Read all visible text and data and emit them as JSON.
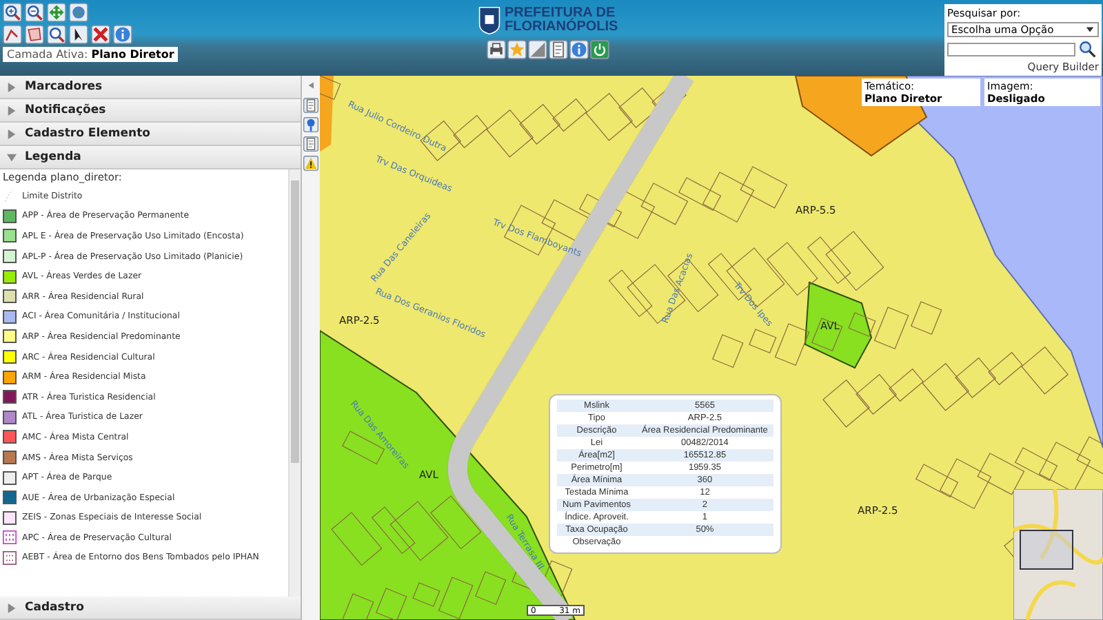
{
  "header": {
    "logo_lines": [
      "PREFEITURA DE",
      "FLORIANÓPOLIS"
    ],
    "active_layer_label": "Camada Ativa:",
    "active_layer": "Plano Diretor"
  },
  "search": {
    "label": "Pesquisar por:",
    "select_value": "Escolha uma Opção",
    "query_builder": "Query Builder"
  },
  "sidebar": {
    "sections": [
      {
        "title": "Marcadores",
        "expanded": false
      },
      {
        "title": "Notificações",
        "expanded": false
      },
      {
        "title": "Cadastro Elemento",
        "expanded": false
      },
      {
        "title": "Legenda",
        "expanded": true,
        "legend": {
          "title": "Legenda plano_diretor:",
          "items": [
            {
              "label": "Limite Distrito",
              "kind": "dots",
              "color": "#c8c8c8"
            },
            {
              "label": "APP - Área de Preservação Permanente",
              "kind": "swatch",
              "color": "#5fb860"
            },
            {
              "label": "APL E - Área de Preservação Uso Limitado (Encosta)",
              "kind": "swatch",
              "color": "#99e08f"
            },
            {
              "label": "APL-P - Área de Preservação Uso Limitado (Planicie)",
              "kind": "swatch",
              "color": "#d4f5d4"
            },
            {
              "label": "AVL - Áreas Verdes de Lazer",
              "kind": "swatch",
              "color": "#99ee00"
            },
            {
              "label": "ARR - Área Residencial Rural",
              "kind": "swatch",
              "color": "#dfe0b0"
            },
            {
              "label": "ACI - Área Comunitária / Institucional",
              "kind": "swatch",
              "color": "#a8b8f0"
            },
            {
              "label": "ARP - Área Residencial Predominante",
              "kind": "swatch",
              "color": "#ffff88"
            },
            {
              "label": "ARC - Área Residencial Cultural",
              "kind": "swatch",
              "color": "#ffff00"
            },
            {
              "label": "ARM - Área Residencial Mista",
              "kind": "swatch",
              "color": "#ffa500"
            },
            {
              "label": "ATR - Área Turistica Residencial",
              "kind": "swatch",
              "color": "#80185a"
            },
            {
              "label": "ATL - Área Turistica de Lazer",
              "kind": "swatch",
              "color": "#b088c8"
            },
            {
              "label": "AMC - Área Mista Central",
              "kind": "swatch",
              "color": "#ff5555"
            },
            {
              "label": "AMS - Área Mista Serviços",
              "kind": "swatch",
              "color": "#b87850"
            },
            {
              "label": "APT - Área de Parque",
              "kind": "swatch",
              "color": "#eeeeee"
            },
            {
              "label": "AUE - Área de Urbanização Especial",
              "kind": "swatch",
              "color": "#106890"
            },
            {
              "label": "ZEIS - Zonas Especiais de Interesse Social",
              "kind": "swatch",
              "color": "#fde4f8"
            },
            {
              "label": "APC - Área de Preservação Cultural",
              "kind": "hatch",
              "color": "#c040c0"
            },
            {
              "label": "AEBT - Área de Entorno dos Bens Tombados pelo IPHAN",
              "kind": "dotted",
              "color": "#905070"
            }
          ]
        }
      },
      {
        "title": "Cadastro",
        "expanded": false
      }
    ]
  },
  "thematic": {
    "tematico_label": "Temático:",
    "tematico_value": "Plano Diretor",
    "imagem_label": "Imagem:",
    "imagem_value": "Desligado"
  },
  "map": {
    "labels": [
      "Rua Julio Cordeiro Dutra",
      "Trv Das Orquideas",
      "Trv Dos Flamboyants",
      "Rua Das Caneleiras",
      "Rua Dos Geranios Floridos",
      "Rua Das Amoreiras",
      "Rua Das Acacias",
      "Trv Dos Ipes",
      "Rua Terrasa III",
      "ARP-5.5",
      "ARP-2.5",
      "ARP-2.5",
      "AVL",
      "AVL"
    ],
    "scale": {
      "start": "0",
      "end": "31 m"
    }
  },
  "popup": {
    "rows": [
      {
        "label": "Mslink",
        "value": "5565"
      },
      {
        "label": "Tipo",
        "value": "ARP-2.5"
      },
      {
        "label": "Descrição",
        "value": "Área Residencial Predominante"
      },
      {
        "label": "Lei",
        "value": "00482/2014"
      },
      {
        "label": "Área[m2]",
        "value": "165512.85"
      },
      {
        "label": "Perimetro[m]",
        "value": "1959.35"
      },
      {
        "label": "Área Mínima",
        "value": "360"
      },
      {
        "label": "Testada Mínima",
        "value": "12"
      },
      {
        "label": "Num Pavimentos",
        "value": "2"
      },
      {
        "label": "Índice. Aproveit.",
        "value": "1"
      },
      {
        "label": "Taxa Ocupação",
        "value": "50%"
      },
      {
        "label": "Observação"
      }
    ]
  }
}
